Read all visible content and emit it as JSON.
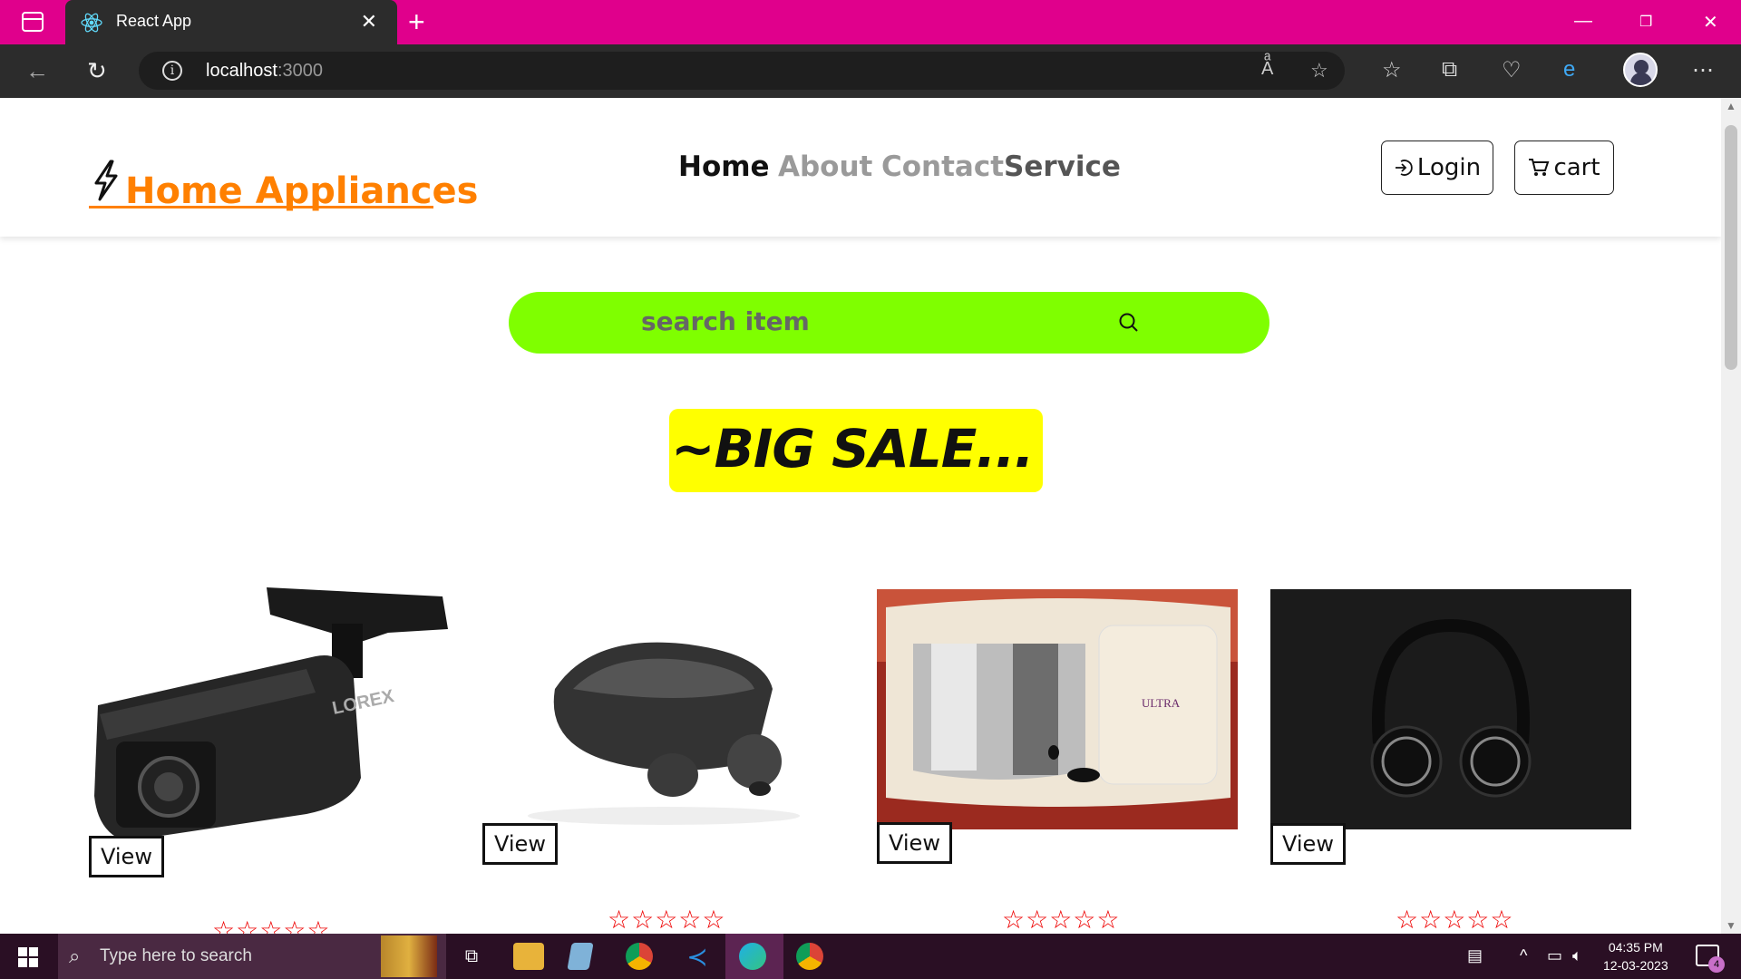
{
  "browser": {
    "tab_title": "React App",
    "url_host": "localhost",
    "url_port": ":3000"
  },
  "navbar": {
    "brand": "Home Appliances",
    "menu": [
      {
        "label": "Home",
        "color": "#111111"
      },
      {
        "label": "About",
        "color": "#9a9a9a"
      },
      {
        "label": "Contact",
        "color": "#9a9a9a"
      },
      {
        "label": "Service",
        "color": "#555555"
      }
    ],
    "login_label": "Login",
    "cart_label": "cart"
  },
  "search": {
    "placeholder": "search item",
    "color": "#7fff00"
  },
  "sale_banner": {
    "text": "~BIG SALE...",
    "color": "#ffff00"
  },
  "products": [
    {
      "name": "security-camera",
      "view_label": "View",
      "stars": "☆☆☆☆☆"
    },
    {
      "name": "wireless-earbuds",
      "view_label": "View",
      "stars": "☆☆☆☆☆"
    },
    {
      "name": "wet-grinder",
      "view_label": "View",
      "stars": "☆☆☆☆☆"
    },
    {
      "name": "headphones",
      "view_label": "View",
      "stars": "☆☆☆☆☆"
    }
  ],
  "taskbar": {
    "search_placeholder": "Type here to search",
    "time": "04:35 PM",
    "date": "12-03-2023",
    "notification_count": "4"
  },
  "colors": {
    "accent": "#ff8000",
    "tabbar": "#e0008c"
  }
}
